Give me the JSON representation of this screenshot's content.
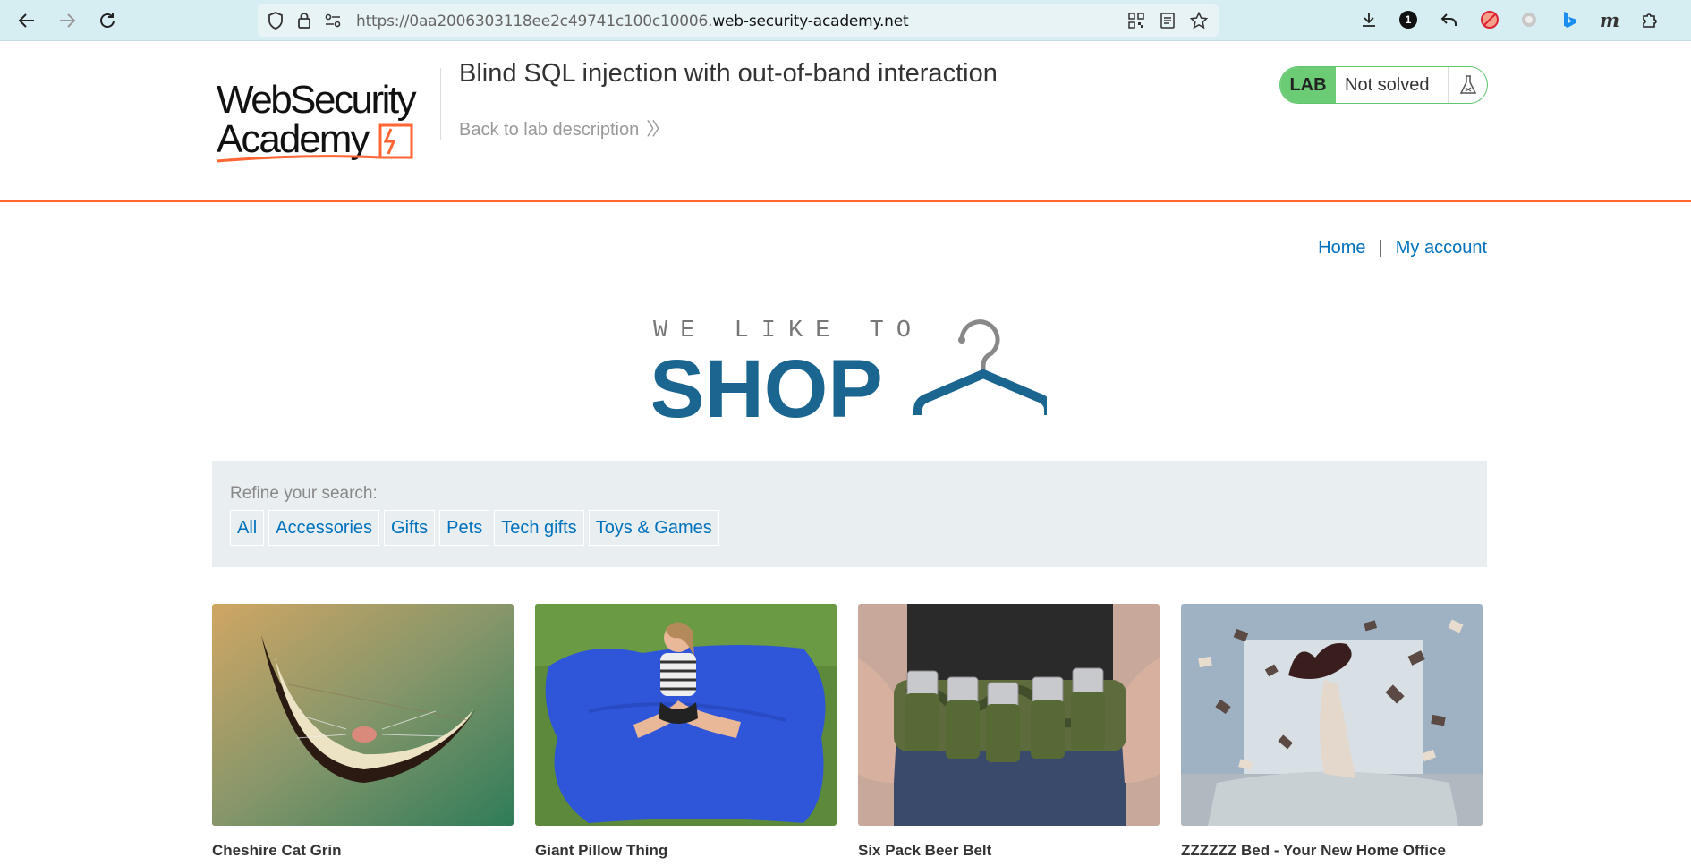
{
  "browser": {
    "url_prefix": "https://0aa2006303118ee2c49741c100c10006.",
    "url_host": "web-security-academy.net",
    "notification_count": "1"
  },
  "academy": {
    "logo_line1": "WebSecurity",
    "logo_line2": "Academy",
    "lab_title": "Blind SQL injection with out-of-band interaction",
    "back_link": "Back to lab description",
    "status_label": "LAB",
    "status_text": "Not solved",
    "accent_color": "#ff6633",
    "status_color": "#6ccb75"
  },
  "nav": {
    "home": "Home",
    "separator": "|",
    "account": "My account"
  },
  "hero": {
    "tagline": "WE LIKE TO",
    "word": "SHOP",
    "brand_color": "#1b6690"
  },
  "filter": {
    "label": "Refine your search:",
    "categories": [
      "All",
      "Accessories",
      "Gifts",
      "Pets",
      "Tech gifts",
      "Toys & Games"
    ]
  },
  "products": [
    {
      "name": "Cheshire Cat Grin",
      "image": "smiling-cat-grin-illustration"
    },
    {
      "name": "Giant Pillow Thing",
      "image": "girl-on-blue-beanbag"
    },
    {
      "name": "Six Pack Beer Belt",
      "image": "camo-beer-can-belt"
    },
    {
      "name": "ZZZZZZ Bed - Your New Home Office",
      "image": "woman-bed-flying-books"
    }
  ]
}
